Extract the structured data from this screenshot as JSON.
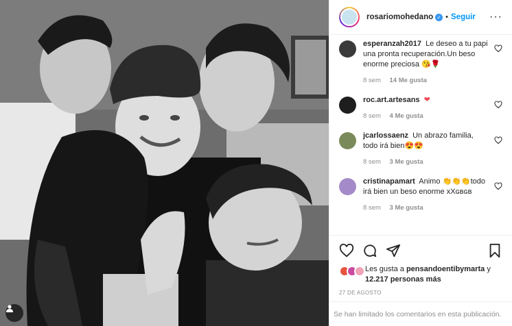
{
  "photo": {
    "alt_icon": "user-tag-icon"
  },
  "header": {
    "username": "rosariomohedano",
    "separator": "•",
    "follow_label": "Seguir",
    "more_label": "···"
  },
  "comments": [
    {
      "user": "esperanzah2017",
      "text": "Le deseo a tu papi una pronta recuperación.Un beso enorme preciosa 😘🌹",
      "time": "8 sem",
      "likes": "14 Me gusta",
      "avatar_color": "#3a3a3a"
    },
    {
      "user": "roc.art.artesans",
      "text": "❤",
      "time": "8 sem",
      "likes": "4 Me gusta",
      "avatar_color": "#1e1e1e"
    },
    {
      "user": "jcarlossaenz",
      "text": "Un abrazo familia, todo irá bien😍😍",
      "time": "8 sem",
      "likes": "3 Me gusta",
      "avatar_color": "#7b8a5a"
    },
    {
      "user": "cristinapamart",
      "text": "Animo 👏👏👏todo irá bien un beso enorme xXɢʙɢʙ",
      "time": "8 sem",
      "likes": "3 Me gusta",
      "avatar_color": "#a58ac9"
    }
  ],
  "actions": {
    "like_icon": "heart-icon",
    "comment_icon": "comment-icon",
    "share_icon": "share-icon",
    "save_icon": "bookmark-icon"
  },
  "likes": {
    "prefix": "Les gusta a",
    "user": "pensandoentibymarta",
    "connector": "y",
    "count": "12.217 personas más",
    "avatar_colors": [
      "#e6543d",
      "#c94aa0",
      "#f0a3b7"
    ]
  },
  "date": "27 DE AGOSTO",
  "footer": {
    "notice": "Se han limitado los comentarios en esta publicación."
  }
}
